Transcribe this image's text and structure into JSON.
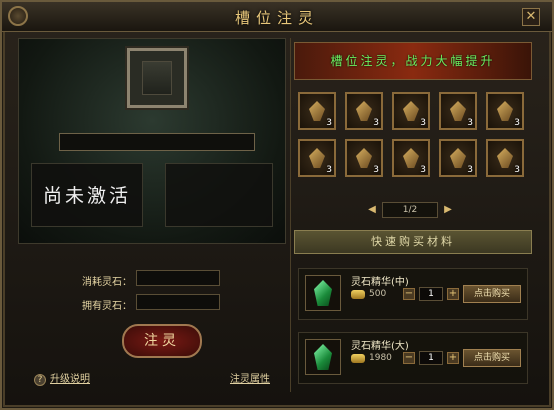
{
  "window": {
    "title": "槽位注灵",
    "close_label": "✕"
  },
  "left": {
    "status_text": "尚未激活",
    "consume_label": "消耗灵石：",
    "own_label": "拥有灵石：",
    "inject_label": "注灵",
    "help_label": "升级说明",
    "attr_label": "注灵属性"
  },
  "right": {
    "banner": "槽位注灵，战力大幅提升",
    "items": [
      {
        "count": "3"
      },
      {
        "count": "3"
      },
      {
        "count": "3"
      },
      {
        "count": "3"
      },
      {
        "count": "3"
      },
      {
        "count": "3"
      },
      {
        "count": "3"
      },
      {
        "count": "3"
      },
      {
        "count": "3"
      },
      {
        "count": "3"
      }
    ],
    "pager": {
      "page": "1/2",
      "prev": "◀",
      "next": "▶"
    },
    "quickbuy_label": "快速购买材料",
    "shop": [
      {
        "name": "灵石精华(中)",
        "price": "500",
        "qty": "1",
        "buy_label": "点击购买"
      },
      {
        "name": "灵石精华(大)",
        "price": "1980",
        "qty": "1",
        "buy_label": "点击购买"
      }
    ]
  },
  "colors": {
    "accent": "#e8c77a",
    "banner_text": "#6af060",
    "inject_bg": "#7a1a14"
  }
}
